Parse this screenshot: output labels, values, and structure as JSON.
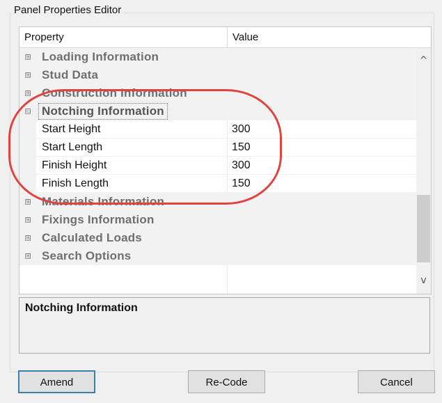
{
  "window": {
    "title": "Panel Properties Editor"
  },
  "grid": {
    "columns": [
      "Property",
      "Value"
    ],
    "categories_before": [
      {
        "label": "Loading Information",
        "expander": "⊞"
      },
      {
        "label": "Stud Data",
        "expander": "⊞"
      },
      {
        "label": "Construction Information",
        "expander": "⊞"
      }
    ],
    "expanded_category": {
      "label": "Notching Information",
      "expander": "⊟"
    },
    "properties": [
      {
        "name": "Start Height",
        "value": "300"
      },
      {
        "name": "Start Length",
        "value": "150"
      },
      {
        "name": "Finish Height",
        "value": "300"
      },
      {
        "name": "Finish Length",
        "value": "150"
      }
    ],
    "categories_after": [
      {
        "label": "Materials Information",
        "expander": "⊞"
      },
      {
        "label": "Fixings Information",
        "expander": "⊞"
      },
      {
        "label": "Calculated Loads",
        "expander": "⊞"
      },
      {
        "label": "Search Options",
        "expander": "⊞"
      }
    ],
    "scroll_up_icon": "^",
    "scroll_down_icon": "v"
  },
  "description": {
    "title": "Notching Information"
  },
  "buttons": {
    "amend": "Amend",
    "recode": "Re-Code",
    "cancel": "Cancel"
  },
  "colors": {
    "highlight": "#e0443f",
    "default_button_border": "#3c7fb1"
  }
}
